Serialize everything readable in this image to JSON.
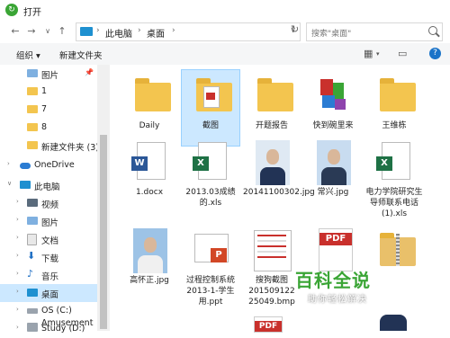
{
  "window": {
    "title": "打开",
    "app_icon": "refresh-circle-icon"
  },
  "address": {
    "crumbs": [
      "此电脑",
      "桌面"
    ],
    "search_placeholder": "搜索\"桌面\""
  },
  "toolbar": {
    "organize": "组织 ▾",
    "new_folder": "新建文件夹",
    "help": "?"
  },
  "sidebar": {
    "items": [
      {
        "label": "图片",
        "icon": "pictures-icon"
      },
      {
        "label": "1",
        "icon": "folder-icon"
      },
      {
        "label": "7",
        "icon": "folder-icon"
      },
      {
        "label": "8",
        "icon": "folder-icon"
      },
      {
        "label": "新建文件夹 (3)",
        "icon": "folder-icon"
      },
      {
        "label": "OneDrive",
        "icon": "cloud-icon"
      },
      {
        "label": "此电脑",
        "icon": "pc-icon"
      },
      {
        "label": "视频",
        "icon": "video-icon"
      },
      {
        "label": "图片",
        "icon": "pictures-icon"
      },
      {
        "label": "文档",
        "icon": "documents-icon"
      },
      {
        "label": "下载",
        "icon": "download-icon"
      },
      {
        "label": "音乐",
        "icon": "music-icon"
      },
      {
        "label": "桌面",
        "icon": "desktop-icon"
      },
      {
        "label": "OS (C:)",
        "icon": "drive-icon"
      },
      {
        "label": "Study (D:)",
        "icon": "drive-icon"
      },
      {
        "label": "Amusement",
        "icon": "drive-icon"
      }
    ]
  },
  "files": [
    {
      "name": "Daily",
      "type": "folder"
    },
    {
      "name": "截图",
      "type": "folder"
    },
    {
      "name": "开题报告",
      "type": "folder"
    },
    {
      "name": "快到碗里来",
      "type": "app"
    },
    {
      "name": "王维栋",
      "type": "folder"
    },
    {
      "name": "1.docx",
      "type": "docx"
    },
    {
      "name": "2013.03成绩的.xls",
      "type": "xls"
    },
    {
      "name": "20141100302.jpg",
      "type": "photo"
    },
    {
      "name": "常兴.jpg",
      "type": "photo"
    },
    {
      "name": "电力学院研究生导师联系电话 (1).xls",
      "type": "xls"
    },
    {
      "name": "高怀正.jpg",
      "type": "photo"
    },
    {
      "name": "过程控制系统2013-1-学生用.ppt",
      "type": "ppt"
    },
    {
      "name": "搜狗截图201509122 25049.bmp",
      "type": "bmp"
    },
    {
      "name": "",
      "type": "pdf"
    },
    {
      "name": "",
      "type": "zip"
    }
  ],
  "watermark": {
    "title": "百科全说",
    "subtitle": "助你轻松解决"
  }
}
